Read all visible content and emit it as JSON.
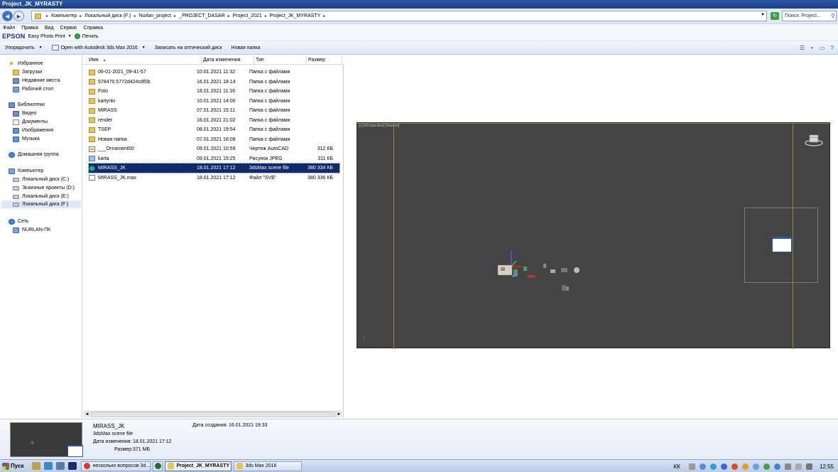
{
  "window": {
    "title": "Project_JK_MYRASTY"
  },
  "address": {
    "crumbs": [
      "Компьютер",
      "Локальный диск (F:)",
      "Nurlan_project",
      "_PROJECT_DASAR",
      "Project_2021",
      "Project_JK_MYRASTY"
    ],
    "search_placeholder": "Поиск: Project..."
  },
  "menu": {
    "items": [
      "Файл",
      "Правка",
      "Вид",
      "Сервис",
      "Справка"
    ]
  },
  "epson": {
    "logo": "EPSON",
    "app": "Easy Photo Print",
    "print": "Печать"
  },
  "toolbar": {
    "organize": "Упорядочить",
    "open_with": "Open with Autodesk 3ds Max 2016",
    "burn": "Записать на оптический диск",
    "new_folder": "Новая папка"
  },
  "nav": {
    "favorites": "Избранное",
    "downloads": "Загрузки",
    "recent": "Недавние места",
    "desktop": "Рабочий стол",
    "libraries": "Библиотеки",
    "video": "Видео",
    "documents": "Документы",
    "images": "Изображения",
    "music": "Музыка",
    "homegroup": "Домашняя группа",
    "computer": "Компьютер",
    "drive_c": "Локальный диск (C:)",
    "drive_d": "Эскизные проекты (D:)",
    "drive_e": "Локальный диск (E:)",
    "drive_f": "Локальный диск (F:)",
    "network": "Сеть",
    "pc": "NURLAN-ПК"
  },
  "columns": {
    "name": "Имя",
    "date": "Дата изменения",
    "type": "Тип",
    "size": "Размер"
  },
  "files": [
    {
      "name": "06-01-2021_09-41-57",
      "date": "10.01.2021 11:32",
      "type": "Папка с файлами",
      "size": "",
      "icon": "folder"
    },
    {
      "name": "578470.5772d424c8f0b",
      "date": "16.01.2021 18:14",
      "type": "Папка с файлами",
      "size": "",
      "icon": "folder"
    },
    {
      "name": "Foto",
      "date": "18.01.2021 11:16",
      "type": "Папка с файлами",
      "size": "",
      "icon": "folder"
    },
    {
      "name": "kartynki",
      "date": "10.01.2021 14:00",
      "type": "Папка с файлами",
      "size": "",
      "icon": "folder"
    },
    {
      "name": "MIRASS",
      "date": "07.01.2021 15:11",
      "type": "Папка с файлами",
      "size": "",
      "icon": "folder"
    },
    {
      "name": "render",
      "date": "16.01.2021 21:02",
      "type": "Папка с файлами",
      "size": "",
      "icon": "folder"
    },
    {
      "name": "TSEP",
      "date": "08.01.2021 19:54",
      "type": "Папка с файлами",
      "size": "",
      "icon": "folder"
    },
    {
      "name": "Новая папка",
      "date": "07.01.2021 16:08",
      "type": "Папка с файлами",
      "size": "",
      "icon": "folder"
    },
    {
      "name": "___Ornament00",
      "date": "09.01.2021 10:59",
      "type": "Чертеж AutoCAD",
      "size": "312 КБ",
      "icon": "dwg"
    },
    {
      "name": "karta",
      "date": "09.01.2021 15:25",
      "type": "Рисунок JPEG",
      "size": "311 КБ",
      "icon": "jpg"
    },
    {
      "name": "MIRASS_JK",
      "date": "18.01.2021 17:12",
      "type": "3dsMax scene file",
      "size": "380 334 КБ",
      "icon": "max",
      "selected": true
    },
    {
      "name": "MIRASS_JK.max",
      "date": "18.01.2021 17:12",
      "type": "Файл \"SV$\"",
      "size": "380 336 КБ",
      "icon": "file"
    }
  ],
  "viewport": {
    "label": "[+] [Perspective] [Shaded]"
  },
  "details": {
    "name": "MIRASS_JK",
    "type": "3dsMax scene file",
    "modified_label": "Дата изменения:",
    "modified": "18.01.2021 17:12",
    "size_label": "Размер:",
    "size": "371 МБ",
    "created_label": "Дата создания:",
    "created": "16.01.2021 19:33"
  },
  "taskbar": {
    "start": "Пуск",
    "tasks": [
      "несколько вопросов 3d...",
      "Project_JK_MYRASTY",
      "3ds Max 2016"
    ],
    "lang": "КК",
    "clock": "12:55"
  },
  "colors": {
    "titlebar": "#1c3f86",
    "selection": "#102b6b",
    "viewport": "#444444"
  }
}
